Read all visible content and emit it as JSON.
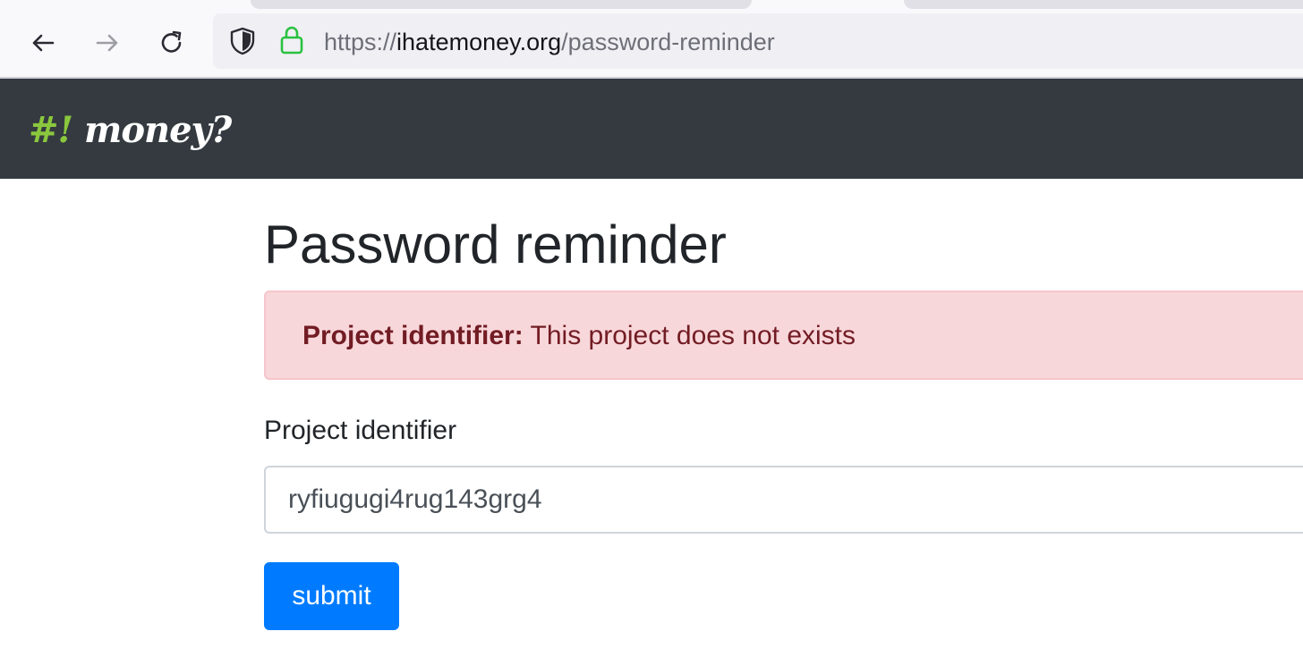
{
  "browser": {
    "url_scheme": "https://",
    "url_host": "ihatemoney.org",
    "url_path": "/password-reminder",
    "icons": {
      "back": "arrow-left-icon",
      "forward": "arrow-right-icon",
      "reload": "reload-icon",
      "tracking_protection": "shield-icon",
      "secure": "lock-icon"
    },
    "secure_color": "#2ac140"
  },
  "navbar": {
    "brand_hash": "#!",
    "brand_word": "money?",
    "background": "#343a40",
    "brand_accent": "#8ac73d"
  },
  "main": {
    "title": "Password reminder",
    "alert": {
      "field": "Project identifier:",
      "message": "This project does not exists",
      "background": "#f8d7da",
      "text_color": "#721c24"
    },
    "form": {
      "label": "Project identifier",
      "input_value": "ryfiugugi4rug143grg4",
      "submit_label": "submit",
      "submit_color": "#007bff"
    }
  }
}
